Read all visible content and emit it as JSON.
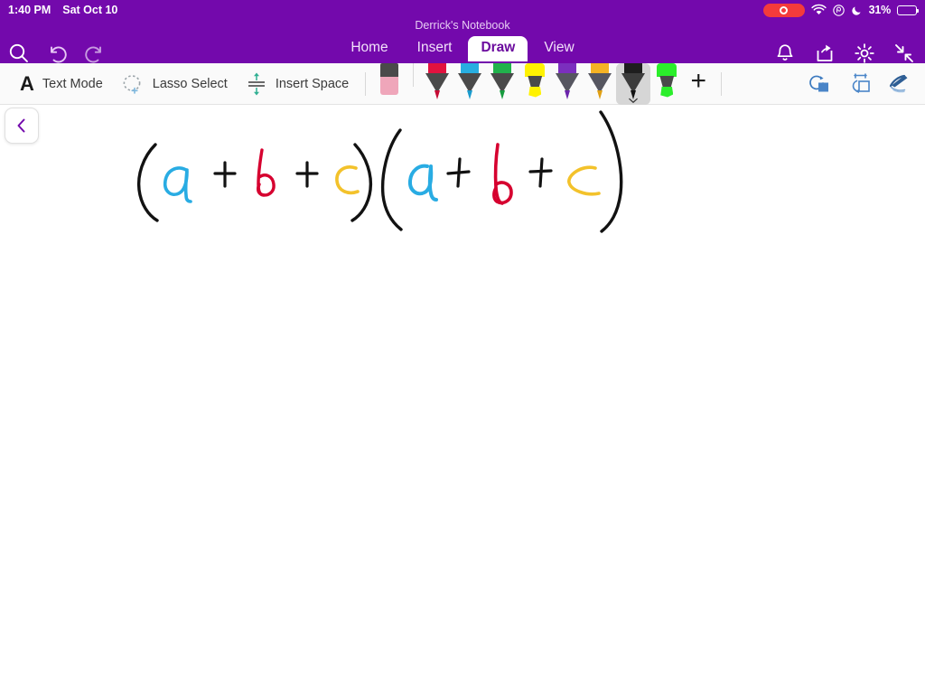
{
  "status_bar": {
    "time": "1:40 PM",
    "date": "Sat Oct 10",
    "battery_percent": "31%",
    "battery_level": 31,
    "icons": [
      "screen-recording-indicator",
      "wifi-icon",
      "orientation-lock-icon",
      "do-not-disturb-moon-icon",
      "battery-icon"
    ]
  },
  "header": {
    "document_title": "Derrick's Notebook",
    "accent_color": "#7309AC",
    "left_icons": [
      "search-icon",
      "undo-icon",
      "redo-icon"
    ],
    "right_icons": [
      "notification-bell-icon",
      "share-icon",
      "settings-gear-icon",
      "collapse-ribbon-icon"
    ],
    "tabs": [
      {
        "label": "Home",
        "active": false
      },
      {
        "label": "Insert",
        "active": false
      },
      {
        "label": "Draw",
        "active": true
      },
      {
        "label": "View",
        "active": false
      }
    ]
  },
  "draw_toolbar": {
    "text_mode_label": "Text Mode",
    "lasso_select_label": "Lasso Select",
    "insert_space_label": "Insert Space",
    "add_pen_label": "+",
    "pens": [
      {
        "name": "eraser",
        "type": "eraser",
        "color": "#EFA6BA",
        "selected": false
      },
      {
        "name": "red-pen",
        "type": "pen",
        "color": "#E2123F",
        "selected": false
      },
      {
        "name": "cyan-pen",
        "type": "pen",
        "color": "#28AEE0",
        "selected": false
      },
      {
        "name": "green-pen",
        "type": "pen",
        "color": "#21B24C",
        "selected": false
      },
      {
        "name": "yellow-highlighter",
        "type": "highlighter",
        "color": "#FFF200",
        "selected": false
      },
      {
        "name": "purple-pen",
        "type": "pen",
        "color": "#7B2FBE",
        "selected": false
      },
      {
        "name": "gold-pen",
        "type": "pen",
        "color": "#F5B324",
        "selected": false
      },
      {
        "name": "black-pen",
        "type": "pen",
        "color": "#1E1E1E",
        "selected": true
      },
      {
        "name": "green-highlighter",
        "type": "highlighter",
        "color": "#2BEE2B",
        "selected": false
      }
    ],
    "right_icons": [
      "ink-to-shape-icon",
      "ink-to-math-icon",
      "ink-to-text-icon"
    ],
    "right_icon_color": "#3B79BF"
  },
  "canvas": {
    "back_button_icon": "chevron-left-icon",
    "back_button_color": "#7309AC",
    "ink_note": "Handwritten expression: ( a + b + c ) ( a + b + c )",
    "ink_colors": {
      "black": "#121212",
      "cyan": "#29ACE3",
      "red": "#D6002F",
      "yellow": "#F3C22B"
    }
  }
}
